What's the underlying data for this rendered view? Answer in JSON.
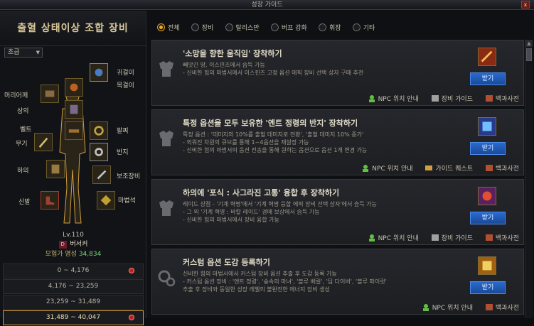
{
  "window": {
    "title": "성장 가이드",
    "close_label": "x"
  },
  "left": {
    "title": "출혈 상태이상 조합 장비",
    "grade": "초급",
    "slots": {
      "ear": "귀걸이",
      "neck": "목걸이",
      "shoulder": "머리어깨",
      "top": "상의",
      "belt": "벨트",
      "weapon": "무기",
      "ring": "반지",
      "bracelet": "팔찌",
      "pants": "하의",
      "sub": "보조장비",
      "shoes": "신발",
      "magic": "마법석"
    },
    "character": {
      "level": "Lv.110",
      "class_badge": "D",
      "class_name": "버서커",
      "fame_label": "모험가 명성",
      "fame_value": "34,834"
    },
    "ranges": [
      {
        "label": "0 ~ 4,176",
        "alert": true
      },
      {
        "label": "4,176 ~ 23,259",
        "alert": false
      },
      {
        "label": "23,259 ~ 31,489",
        "alert": false
      },
      {
        "label": "31,489 ~ 40,047",
        "alert": true
      }
    ]
  },
  "filters": [
    {
      "label": "전체",
      "checked": true
    },
    {
      "label": "장비",
      "checked": false
    },
    {
      "label": "탈리스만",
      "checked": false
    },
    {
      "label": "버프 강화",
      "checked": false
    },
    {
      "label": "휘장",
      "checked": false
    },
    {
      "label": "기타",
      "checked": false
    }
  ],
  "cards": [
    {
      "title": "'소망을 향한 움직임' 장착하기",
      "desc": "빼앗긴 땅, 이스핀즈에서 습득 가능\n- 신비한 힘의 마법서에서 이스핀즈 고정 옵션 에픽 장비 선택 상자 구매 추천",
      "button": "받기",
      "links": [
        "NPC 위치 안내",
        "장비 가이드",
        "백과사전"
      ]
    },
    {
      "title": "특정 옵션을 모두 보유한 '엔트 정령의 반지' 장착하기",
      "desc": "특정 옵션 : '데미지의 10%를 출혈 데미지로 전환', '출혈 데미지 10% 증가'\n- 외워진 차원의 큐브를 통해 1~4옵션을 재설정 가능\n- 신비한 힘의 마법서의 옵션 전송을 통해 원하는 옵션으로 옵션 1개 변경 가능",
      "button": "받기",
      "links": [
        "NPC 위치 안내",
        "가이드 퀘스트",
        "백과사전"
      ]
    },
    {
      "title": "하의에 '포식 : 사그라진 고통' 융합 후 장착하기",
      "desc": "레이드 상점 - '기계 혁명'에서 '기계 혁명 융합 에픽 장비 선택 상자'에서 습득 가능\n- 그 외 '기계 혁명 : 바칼 레이드' 경매 보상에서 습득 가능\n- 신비한 힘의 마법서에서 장비 융합 가능",
      "button": "받기",
      "links": [
        "NPC 위치 안내",
        "장비 가이드",
        "백과사전"
      ]
    },
    {
      "title": "커스텀 옵션 도감 등록하기",
      "desc": "신비한 힘의 마법서에서 커스텀 장비 옵션 추출 후 도감 등록 가능\n- 커스텀 옵션 장비 : '엔트 정령', '숲속의 마녀', '블루 베릴', '딥 다이버', '블루 파이럿'\n추출 후 장비와 동일한 성장 레벨의 불완전한 에너지 장비 생성",
      "button": "받기",
      "links": [
        "NPC 위치 안내",
        "백과사전"
      ]
    }
  ],
  "colors": {
    "accent": "#d0a040",
    "button": "#2a6ad0",
    "fame": "#7fd07f",
    "alert": "#c02020"
  }
}
